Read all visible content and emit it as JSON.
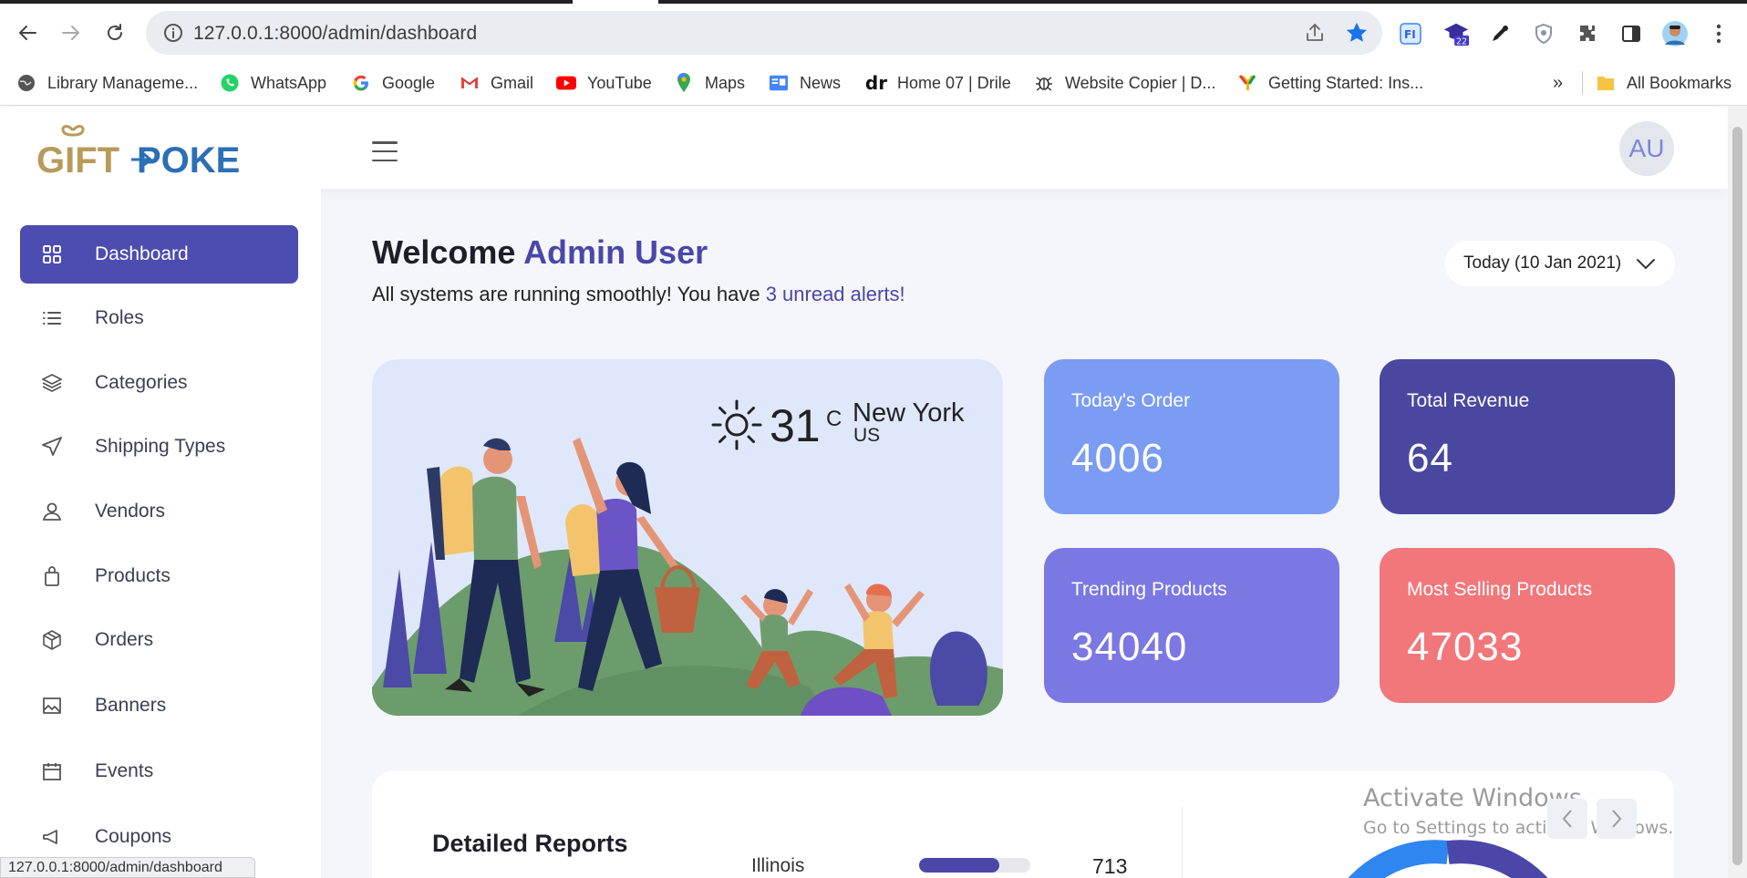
{
  "browser": {
    "url": "127.0.0.1:8000/admin/dashboard",
    "bookmarks": [
      {
        "label": "Library Manageme..."
      },
      {
        "label": "WhatsApp"
      },
      {
        "label": "Google"
      },
      {
        "label": "Gmail"
      },
      {
        "label": "YouTube"
      },
      {
        "label": "Maps"
      },
      {
        "label": "News"
      },
      {
        "label": "Home 07 | Drile"
      },
      {
        "label": "Website Copier | D..."
      },
      {
        "label": "Getting Started: Ins..."
      }
    ],
    "overflow_label": "»",
    "all_bookmarks_label": "All Bookmarks",
    "extension_badge": "22",
    "status_url": "127.0.0.1:8000/admin/dashboard"
  },
  "header": {
    "logo_text_gift": "GIFT",
    "logo_text_poke": "POKE",
    "avatar_initials": "AU"
  },
  "sidebar": {
    "items": [
      {
        "label": "Dashboard",
        "icon": "grid-icon"
      },
      {
        "label": "Roles",
        "icon": "list-icon"
      },
      {
        "label": "Categories",
        "icon": "layers-icon"
      },
      {
        "label": "Shipping Types",
        "icon": "send-icon"
      },
      {
        "label": "Vendors",
        "icon": "user-icon"
      },
      {
        "label": "Products",
        "icon": "bag-icon"
      },
      {
        "label": "Orders",
        "icon": "box-icon"
      },
      {
        "label": "Banners",
        "icon": "image-icon"
      },
      {
        "label": "Events",
        "icon": "calendar-icon"
      },
      {
        "label": "Coupons",
        "icon": "megaphone-icon"
      }
    ]
  },
  "main": {
    "welcome_prefix": "Welcome ",
    "welcome_name": "Admin User",
    "subtitle_prefix": "All systems are running smoothly! You have ",
    "subtitle_link": "3 unread alerts!",
    "date_label": "Today (10 Jan 2021)",
    "weather": {
      "temp": "31",
      "unit": "C",
      "city": "New York",
      "country": "US"
    },
    "stats": [
      {
        "label": "Today's Order",
        "value": "4006",
        "color": "#7b9cf3"
      },
      {
        "label": "Total Revenue",
        "value": "64",
        "color": "#4a47a1"
      },
      {
        "label": "Trending Products",
        "value": "34040",
        "color": "#7b78e3"
      },
      {
        "label": "Most Selling Products",
        "value": "47033",
        "color": "#f1777a"
      }
    ],
    "report": {
      "title": "Detailed Reports",
      "rows": [
        {
          "state": "Illinois",
          "value": "713",
          "fraction": 0.72
        }
      ]
    }
  },
  "watermark": {
    "line1": "Activate Windows",
    "line2": "Go to Settings to activate Windows."
  },
  "colors": {
    "accent": "#4d4cb0",
    "bg": "#f4f6fb"
  }
}
